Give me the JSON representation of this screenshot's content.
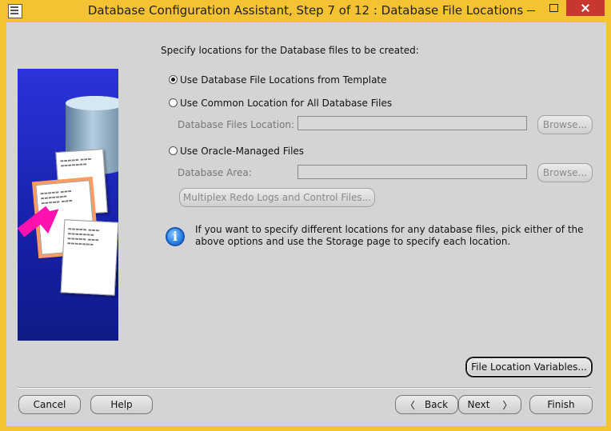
{
  "window": {
    "title": "Database Configuration Assistant, Step 7 of 12 : Database File Locations"
  },
  "main": {
    "instructions": "Specify locations for the Database files to be created:",
    "options": [
      {
        "label": "Use Database File Locations from Template",
        "selected": true
      },
      {
        "label": "Use Common Location for All Database Files",
        "selected": false
      },
      {
        "label": "Use Oracle-Managed Files",
        "selected": false
      }
    ],
    "database_files_location_label": "Database Files Location:",
    "database_area_label": "Database Area:",
    "browse_label": "Browse...",
    "multiplex_label": "Multiplex Redo Logs and Control Files...",
    "info_line_1": "If you want to specify different locations for any database files, pick either of the",
    "info_line_2": "above options and use the Storage page to specify each location.",
    "file_location_variables_label": "File Location Variables..."
  },
  "footer": {
    "cancel": "Cancel",
    "help": "Help",
    "back": "Back",
    "next": "Next",
    "finish": "Finish"
  },
  "icons": {
    "info": "info-icon",
    "app": "database-config-icon"
  },
  "colors": {
    "title_bar": "#f4c232",
    "panel": "#d4d4d4",
    "illustration_blue": "#1720a8",
    "close_button": "#c7372f"
  }
}
